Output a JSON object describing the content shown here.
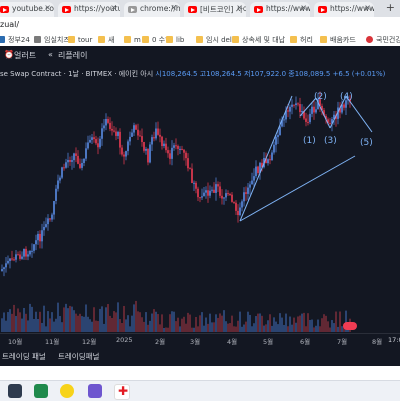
{
  "tabs": [
    {
      "title": "youtube.com",
      "favicon": "youtube-icon",
      "left": -4,
      "width": 58
    },
    {
      "title": "https://youtu",
      "favicon": "youtube-icon",
      "left": 58,
      "width": 62
    },
    {
      "title": "chrome://his",
      "favicon": "chrome-icon",
      "left": 124,
      "width": 56
    },
    {
      "title": "[비트코인] 사이",
      "favicon": "youtube-icon",
      "left": 184,
      "width": 62
    },
    {
      "title": "https://www.y",
      "favicon": "youtube-icon",
      "left": 250,
      "width": 60
    },
    {
      "title": "https://www.y",
      "favicon": "youtube-icon",
      "left": 314,
      "width": 60
    }
  ],
  "address": {
    "url": "zual/"
  },
  "bookmarks": [
    {
      "label": "정부24",
      "icon": "gov-icon"
    },
    {
      "label": "임실치즈",
      "icon": "link-icon"
    },
    {
      "label": "tour",
      "icon": "folder-icon"
    },
    {
      "label": "새",
      "icon": "folder-icon"
    },
    {
      "label": "m",
      "icon": "folder-icon"
    },
    {
      "label": "0 수험",
      "icon": "folder-icon"
    },
    {
      "label": "lib",
      "icon": "folder-icon"
    },
    {
      "label": "임시 del",
      "icon": "folder-icon"
    },
    {
      "label": "상속세 및 대납",
      "icon": "folder-icon"
    },
    {
      "label": "허리",
      "icon": "folder-icon"
    },
    {
      "label": "배움카드",
      "icon": "folder-icon"
    },
    {
      "label": "국민건강",
      "icon": "nhis-icon"
    }
  ],
  "toolbar": {
    "alert": "얼러트",
    "replay": "리플레이"
  },
  "legend": {
    "symbol": "se Swap Contract · 1날 · BITMEX · 에이킨 아시",
    "ohlc": "시108,264.5  고108,264.5  저107,922.0  종108,089.5  +6.5 (+0.01%)"
  },
  "wave_labels": [
    "(1)",
    "(2)",
    "(3)",
    "(4)",
    "(5)"
  ],
  "xaxis": {
    "labels": [
      "10월",
      "11월",
      "12월",
      "2025",
      "2월",
      "3월",
      "4월",
      "5월",
      "6월",
      "7월",
      "8월"
    ],
    "time": "17:0"
  },
  "bottom_tabs": {
    "trading1": "트레이딩 패널",
    "trading2": "트레이딩패널"
  },
  "colors": {
    "bg": "#131722",
    "up": "#5b8de8",
    "down": "#f03c53",
    "wave": "#7fb3f5"
  },
  "chart_data": {
    "type": "candlestick",
    "title": "",
    "xlabel": "",
    "ylabel": "",
    "x_ticks": [
      "10월",
      "11월",
      "12월",
      "2025",
      "2월",
      "3월",
      "4월",
      "5월",
      "6월",
      "7월",
      "8월"
    ],
    "wave_points": [
      "(1)",
      "(2)",
      "(3)",
      "(4)",
      "(5)"
    ],
    "last_close": 108089.5
  }
}
